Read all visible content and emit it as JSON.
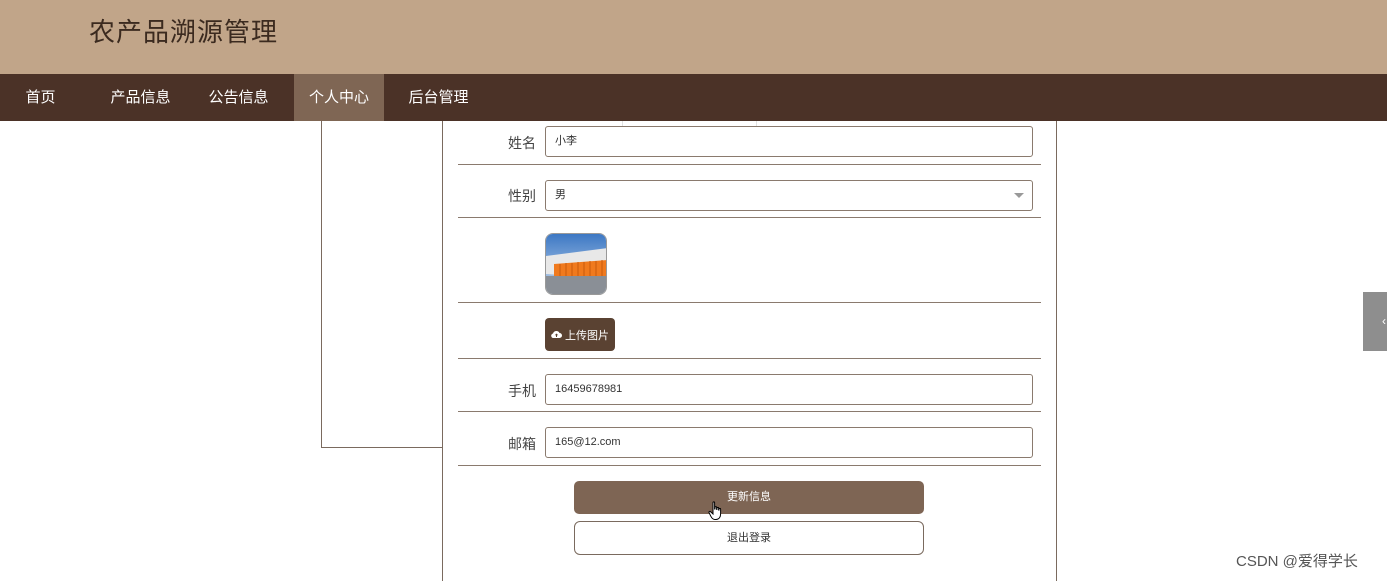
{
  "header": {
    "title": "农产品溯源管理"
  },
  "nav": {
    "items": [
      {
        "label": "首页"
      },
      {
        "label": "产品信息"
      },
      {
        "label": "公告信息"
      },
      {
        "label": "个人中心"
      },
      {
        "label": "后台管理"
      }
    ],
    "active_index": 3
  },
  "form": {
    "name": {
      "label": "姓名",
      "value": "小李"
    },
    "gender": {
      "label": "性别",
      "value": "男"
    },
    "avatar": {
      "icon": "avatar-image"
    },
    "upload": {
      "label": "上传图片",
      "icon": "cloud-upload-icon"
    },
    "phone": {
      "label": "手机",
      "value": "16459678981"
    },
    "email": {
      "label": "邮箱",
      "value": "165@12.com"
    }
  },
  "actions": {
    "update_label": "更新信息",
    "logout_label": "退出登录"
  },
  "side_tab": {
    "glyph": "‹"
  },
  "watermark": "CSDN @爱得学长",
  "colors": {
    "header_bg": "#c1a589",
    "nav_bg": "#4b3227",
    "nav_active": "#7f6654",
    "primary_button": "#7e6554",
    "upload_button": "#5a4232"
  }
}
